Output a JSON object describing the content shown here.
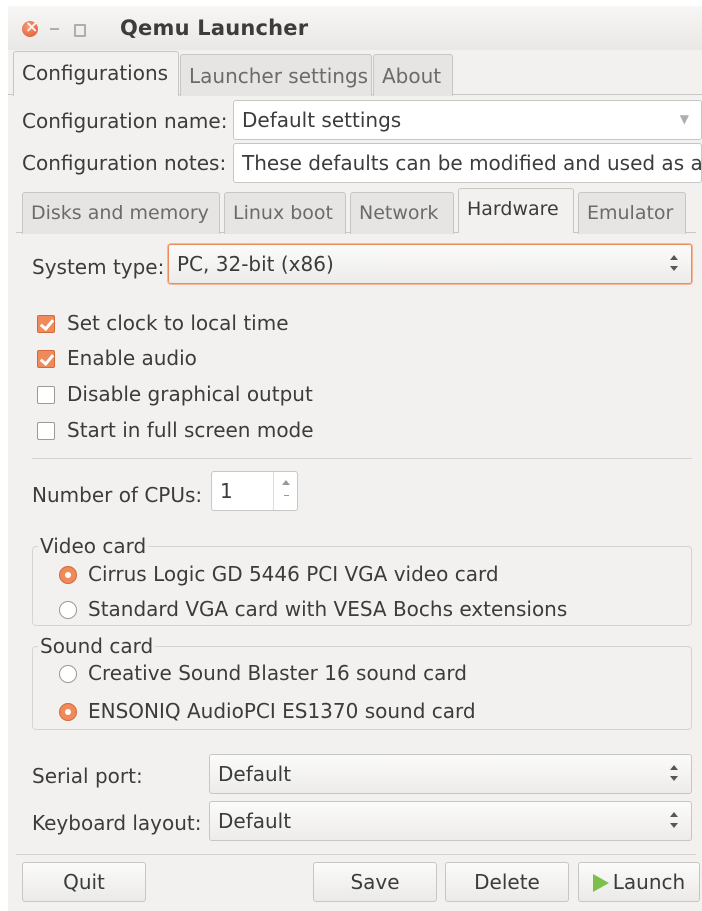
{
  "window": {
    "title": "Qemu Launcher"
  },
  "main_tabs": [
    {
      "label": "Configurations",
      "active": true
    },
    {
      "label": "Launcher settings",
      "active": false
    },
    {
      "label": "About",
      "active": false
    }
  ],
  "config": {
    "name_label": "Configuration name:",
    "name_value": "Default settings",
    "notes_label": "Configuration notes:",
    "notes_value": "These defaults can be modified and used as a b"
  },
  "sub_tabs": [
    {
      "label": "Disks and memory",
      "active": false
    },
    {
      "label": "Linux boot",
      "active": false
    },
    {
      "label": "Network",
      "active": false
    },
    {
      "label": "Hardware",
      "active": true
    },
    {
      "label": "Emulator",
      "active": false
    }
  ],
  "hardware": {
    "system_type_label": "System type:",
    "system_type_value": "PC, 32-bit (x86)",
    "checkboxes": [
      {
        "label": "Set clock to local time",
        "checked": true
      },
      {
        "label": "Enable audio",
        "checked": true
      },
      {
        "label": "Disable graphical output",
        "checked": false
      },
      {
        "label": "Start in full screen mode",
        "checked": false
      }
    ],
    "cpus_label": "Number of CPUs:",
    "cpus_value": "1",
    "video_card": {
      "title": "Video card",
      "options": [
        {
          "label": "Cirrus Logic GD 5446 PCI VGA video card",
          "selected": true
        },
        {
          "label": "Standard VGA card with VESA Bochs extensions",
          "selected": false
        }
      ]
    },
    "sound_card": {
      "title": "Sound card",
      "options": [
        {
          "label": "Creative Sound Blaster 16 sound card",
          "selected": false
        },
        {
          "label": "ENSONIQ AudioPCI ES1370 sound card",
          "selected": true
        }
      ]
    },
    "serial_port_label": "Serial port:",
    "serial_port_value": "Default",
    "keyboard_label": "Keyboard layout:",
    "keyboard_value": "Default"
  },
  "buttons": {
    "quit": "Quit",
    "save": "Save",
    "delete": "Delete",
    "launch": "Launch"
  },
  "colors": {
    "accent": "#ef8a5b",
    "launch_icon": "#7cc04b",
    "window_bg": "#f2f1f0"
  }
}
